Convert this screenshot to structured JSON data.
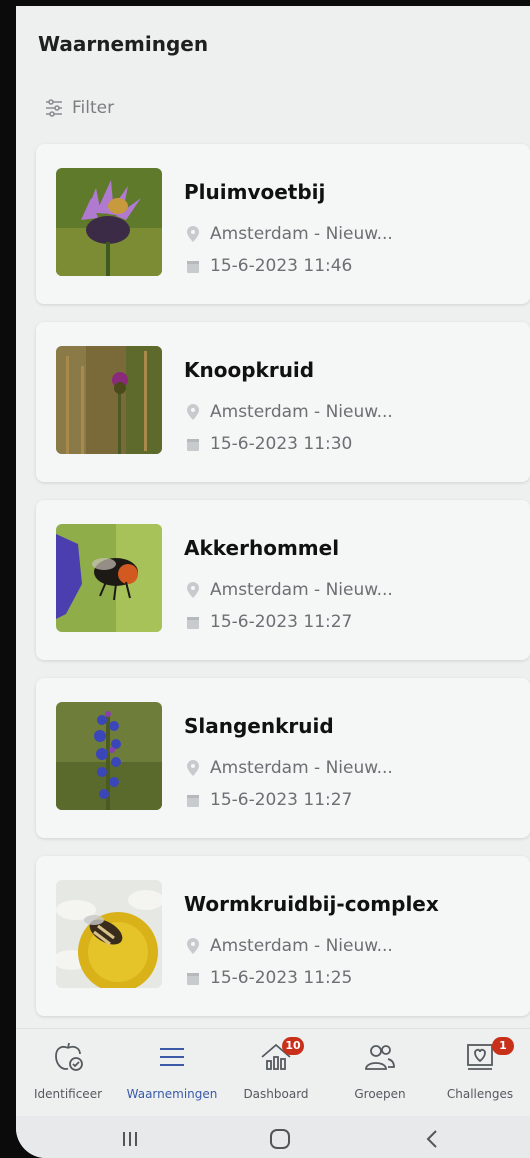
{
  "header": {
    "title": "Waarnemingen"
  },
  "filter": {
    "label": "Filter"
  },
  "observations": [
    {
      "name": "Pluimvoetbij",
      "location": "Amsterdam - Nieuw...",
      "datetime": "15-6-2023 11:46",
      "image_icon": "bee-on-thistle"
    },
    {
      "name": "Knoopkruid",
      "location": "Amsterdam - Nieuw...",
      "datetime": "15-6-2023 11:30",
      "image_icon": "knapweed-flower"
    },
    {
      "name": "Akkerhommel",
      "location": "Amsterdam - Nieuw...",
      "datetime": "15-6-2023 11:27",
      "image_icon": "bumblebee"
    },
    {
      "name": "Slangenkruid",
      "location": "Amsterdam - Nieuw...",
      "datetime": "15-6-2023 11:27",
      "image_icon": "vipers-bugloss"
    },
    {
      "name": "Wormkruidbij-complex",
      "location": "Amsterdam - Nieuw...",
      "datetime": "15-6-2023 11:25",
      "image_icon": "bee-on-daisy"
    }
  ],
  "nav": {
    "items": [
      {
        "label": "Identificeer",
        "icon": "apple-check-icon"
      },
      {
        "label": "Waarnemingen",
        "icon": "list-icon",
        "active": true
      },
      {
        "label": "Dashboard",
        "icon": "home-chart-icon",
        "badge": "10"
      },
      {
        "label": "Groepen",
        "icon": "people-icon"
      },
      {
        "label": "Challenges",
        "icon": "heart-flag-icon",
        "badge": "1"
      }
    ]
  },
  "colors": {
    "accent": "#3a5aa8",
    "badge": "#c9301a",
    "background": "#eef0f0"
  }
}
